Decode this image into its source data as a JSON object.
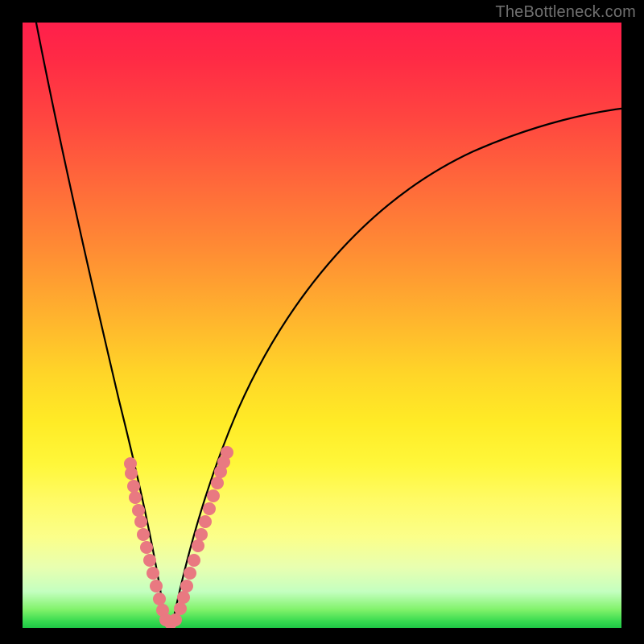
{
  "watermark": "TheBottleneck.com",
  "colors": {
    "frame_border": "#000000",
    "curve_stroke": "#000000",
    "dot_fill": "#e97981",
    "gradient_top": "#ff1f4b",
    "gradient_bottom": "#1fc746"
  },
  "chart_data": {
    "type": "line",
    "title": "",
    "xlabel": "",
    "ylabel": "",
    "xlim": [
      0,
      100
    ],
    "ylim": [
      0,
      100
    ],
    "notes": "V-shaped bottleneck curve on rainbow gradient background. Minimum (0%) at x≈24. Left branch rises to 100% near x=0; right branch rises to ≈85% at x=100. Sample points cluster near the bottom of both branches.",
    "series": [
      {
        "name": "left_branch",
        "x": [
          2,
          5,
          8,
          11,
          14,
          17,
          19,
          21,
          23,
          24
        ],
        "y": [
          100,
          88,
          75,
          62,
          48,
          34,
          22,
          12,
          4,
          0
        ]
      },
      {
        "name": "right_branch",
        "x": [
          24,
          26,
          28,
          31,
          35,
          40,
          46,
          54,
          64,
          76,
          88,
          100
        ],
        "y": [
          0,
          4,
          10,
          18,
          28,
          38,
          48,
          58,
          67,
          75,
          81,
          85
        ]
      },
      {
        "name": "sample_points",
        "x": [
          18.5,
          18.5,
          19,
          20,
          20,
          21,
          21.2,
          21.5,
          22.5,
          22.6,
          23.5,
          23.6,
          24.0,
          24.5,
          25.0,
          25.0,
          26.0,
          27.0,
          27.2,
          28.0,
          28.0,
          28.5,
          29.5,
          30.0,
          30.5,
          31.5,
          31.7,
          32.0,
          32.5,
          33.0
        ],
        "y": [
          26,
          28,
          24,
          20,
          18,
          14,
          16,
          12,
          8,
          10,
          4,
          6,
          2,
          2,
          2,
          3,
          4,
          7,
          6,
          10,
          12,
          11,
          16,
          18,
          19,
          22,
          24,
          23,
          27,
          28
        ]
      }
    ]
  }
}
